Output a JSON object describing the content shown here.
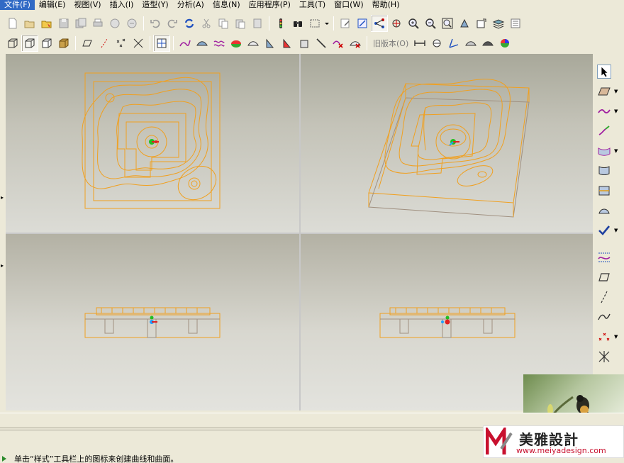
{
  "menubar": {
    "items": [
      {
        "label": "文件(F)",
        "active": true
      },
      {
        "label": "编辑(E)"
      },
      {
        "label": "视图(V)"
      },
      {
        "label": "插入(I)"
      },
      {
        "label": "造型(Y)"
      },
      {
        "label": "分析(A)"
      },
      {
        "label": "信息(N)"
      },
      {
        "label": "应用程序(P)"
      },
      {
        "label": "工具(T)"
      },
      {
        "label": "窗口(W)"
      },
      {
        "label": "帮助(H)"
      }
    ]
  },
  "toolbar2": {
    "old_version_label": "旧版本(O)"
  },
  "viewports": {
    "names": [
      "top-view",
      "isometric-view",
      "front-view",
      "side-view"
    ]
  },
  "status": {
    "message": "单击“样式”工具栏上的图标来创建曲线和曲面。"
  },
  "watermark": {
    "brand_cn": "美雅設計",
    "url": "www.meiyadesign.com"
  },
  "colors": {
    "model_edge": "#f0a020",
    "menu_highlight": "#316ac5",
    "chrome": "#ece9d8",
    "axis_x": "#e02020",
    "axis_y": "#20c020",
    "axis_z": "#20a0ff"
  },
  "icons": {
    "right_toolbar": [
      "select-arrow-icon",
      "datum-plane-icon",
      "style-curve-icon",
      "sketch-curve-icon",
      "surface-icon",
      "boundary-surface-icon",
      "trim-surface-icon",
      "surface-connect-icon",
      "done-check-icon",
      "curve-on-surface-icon",
      "plane-icon",
      "axis-icon",
      "spline-icon",
      "point-icon",
      "csys-icon"
    ]
  }
}
